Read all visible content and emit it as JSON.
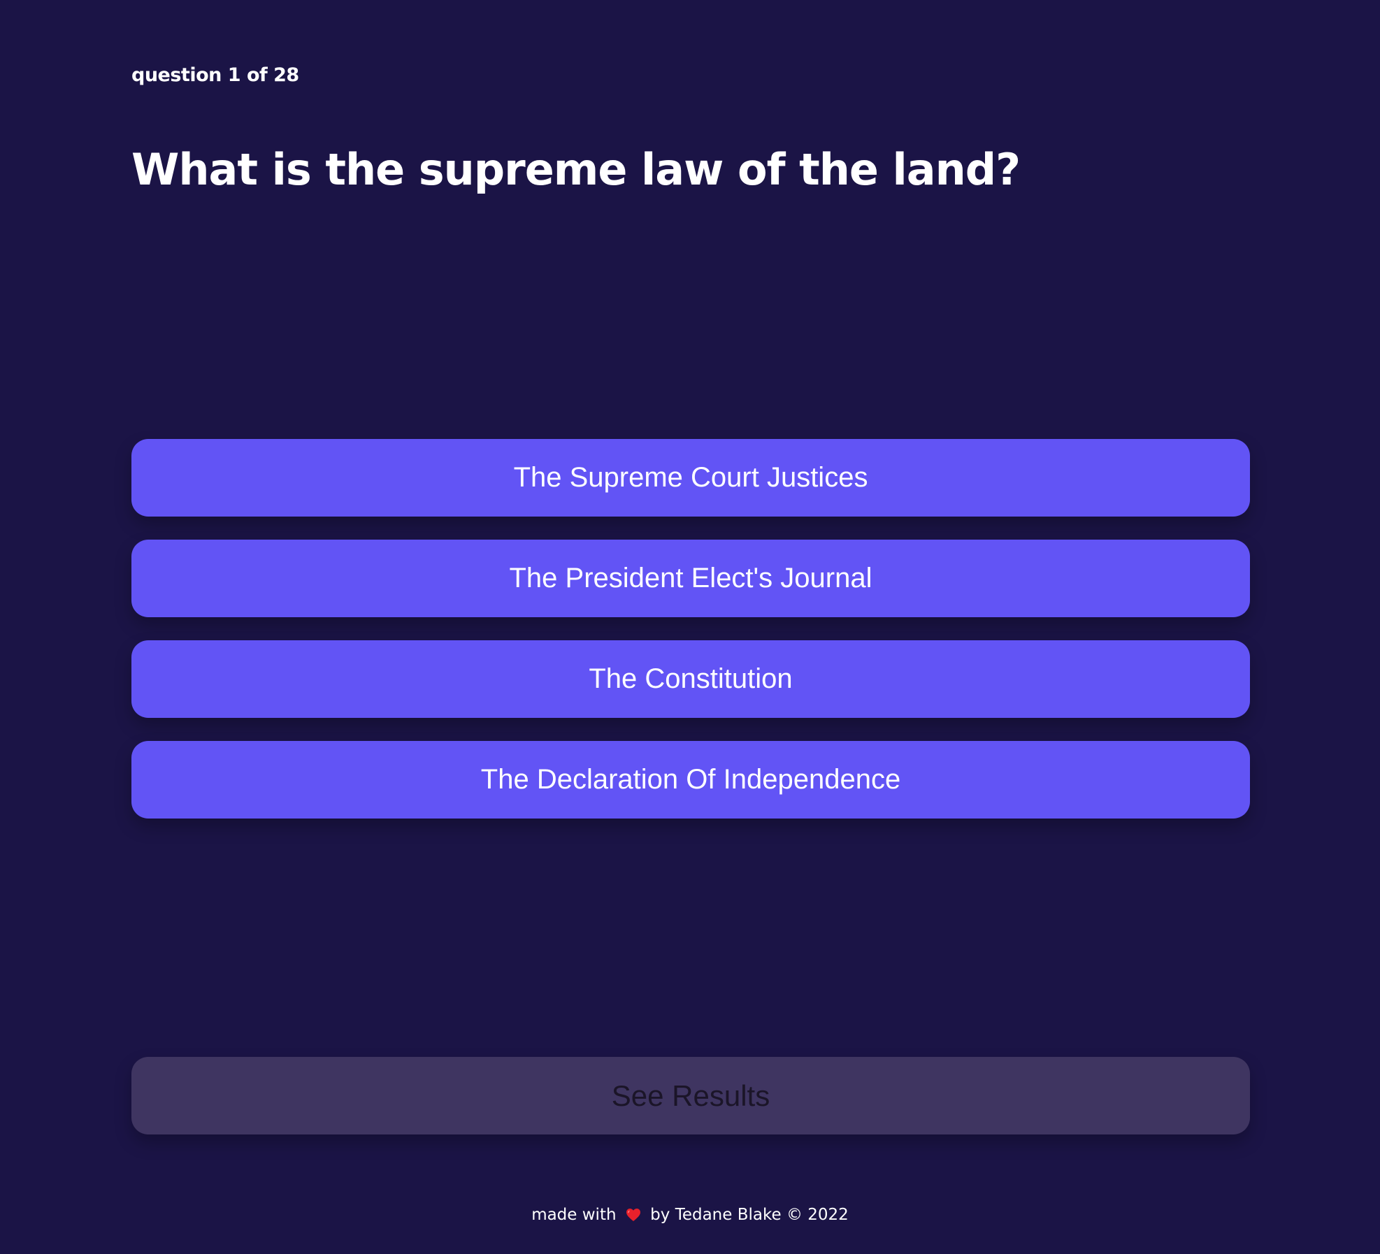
{
  "quiz": {
    "progress_label": "question 1 of 28",
    "question": "What is the supreme law of the land?",
    "answers": [
      "The Supreme Court Justices",
      "The President Elect's Journal",
      "The Constitution",
      "The Declaration Of Independence"
    ],
    "results_label": "See Results"
  },
  "footer": {
    "prefix": "made with",
    "icon": "heart-icon",
    "suffix": "by Tedane Blake © 2022"
  },
  "colors": {
    "background": "#1b1446",
    "answer_button": "#6254f5",
    "results_button_disabled": "#3f3561",
    "heart": "#e8212b"
  }
}
